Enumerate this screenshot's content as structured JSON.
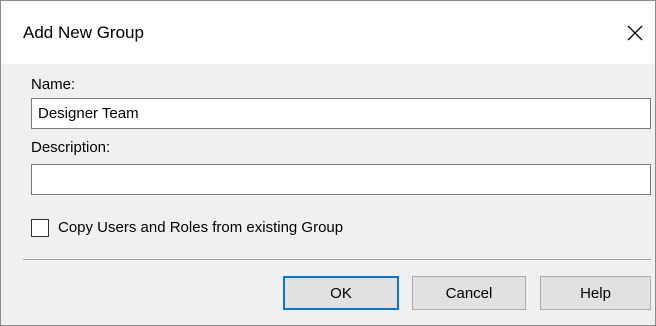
{
  "dialog": {
    "title": "Add New Group",
    "close_icon": "close-icon"
  },
  "form": {
    "name_label": "Name:",
    "name_value": "Designer Team",
    "description_label": "Description:",
    "description_value": "",
    "copy_checkbox_label": "Copy Users and Roles from existing Group",
    "copy_checked": false
  },
  "buttons": {
    "ok_label": "OK",
    "cancel_label": "Cancel",
    "help_label": "Help"
  },
  "colors": {
    "default_button_border": "#0078d7",
    "dialog_background": "#f0f0f0",
    "titlebar_background": "#ffffff"
  }
}
